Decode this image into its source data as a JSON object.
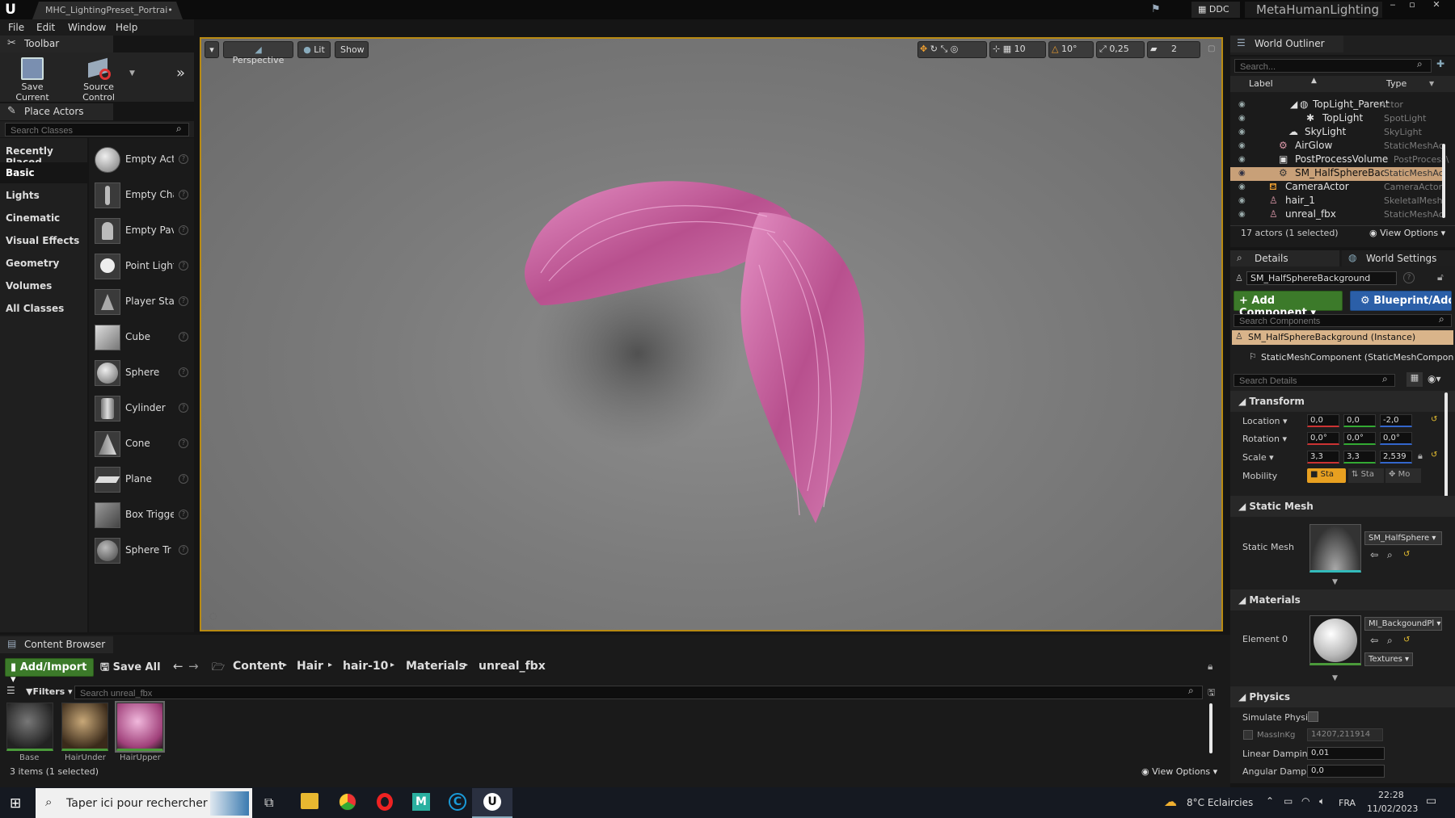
{
  "app": {
    "tab_title": "MHC_LightingPreset_Portrai•",
    "ddc": "DDC",
    "project": "MetaHumanLighting"
  },
  "menu": [
    "File",
    "Edit",
    "Window",
    "Help"
  ],
  "toolbar": {
    "tab": "Toolbar",
    "save_current": "Save Current",
    "source_control": "Source Control"
  },
  "place_actors": {
    "tab": "Place Actors",
    "search_placeholder": "Search Classes",
    "categories": [
      "Recently Placed",
      "Basic",
      "Lights",
      "Cinematic",
      "Visual Effects",
      "Geometry",
      "Volumes",
      "All Classes"
    ],
    "selected_category": "Basic",
    "items": [
      "Empty Act",
      "Empty Cha",
      "Empty Pav",
      "Point Light",
      "Player Sta",
      "Cube",
      "Sphere",
      "Cylinder",
      "Cone",
      "Plane",
      "Box Trigge",
      "Sphere Tr"
    ]
  },
  "viewport": {
    "perspective": "Perspective",
    "lit": "Lit",
    "show": "Show",
    "grid_snap": "10",
    "rot_snap": "10°",
    "scale_snap": "0,25",
    "cam_speed": "2"
  },
  "outliner": {
    "tab": "World Outliner",
    "search_placeholder": "Search...",
    "col_label": "Label",
    "col_type": "Type",
    "rows": [
      {
        "label": "TopLight_Parent",
        "type": "Actor",
        "indent": 1
      },
      {
        "label": "TopLight",
        "type": "SpotLight",
        "indent": 2
      },
      {
        "label": "SkyLight",
        "type": "SkyLight",
        "indent": 1
      },
      {
        "label": "AirGlow",
        "type": "StaticMeshAc",
        "indent": 0
      },
      {
        "label": "PostProcessVolume",
        "type": "PostProcess\\",
        "indent": 0
      },
      {
        "label": "SM_HalfSphereBackg",
        "type": "StaticMeshAc",
        "indent": 0
      },
      {
        "label": "CameraActor",
        "type": "CameraActor",
        "indent": 0
      },
      {
        "label": "hair_1",
        "type": "SkeletalMesh",
        "indent": 0
      },
      {
        "label": "unreal_fbx",
        "type": "StaticMeshAc",
        "indent": 0
      }
    ],
    "status": "17 actors (1 selected)",
    "view_options": "View Options"
  },
  "details": {
    "tab": "Details",
    "tab2": "World Settings",
    "object_name": "SM_HalfSphereBackground",
    "add_component": "Add Component",
    "blueprint": "Blueprint/Add",
    "search_components": "Search Components",
    "instance": "SM_HalfSphereBackground (Instance)",
    "component": "StaticMeshComponent (StaticMeshComponent",
    "search_details": "Search Details",
    "transform": "Transform",
    "location_label": "Location",
    "location": [
      "0,0",
      "0,0",
      "-2,0"
    ],
    "rotation_label": "Rotation",
    "rotation": [
      "0,0°",
      "0,0°",
      "0,0°"
    ],
    "scale_label": "Scale",
    "scale": [
      "3,3",
      "3,3",
      "2,539"
    ],
    "mobility_label": "Mobility",
    "mobility": [
      "Sta",
      "Sta",
      "Mo"
    ],
    "static_mesh_section": "Static Mesh",
    "static_mesh_label": "Static Mesh",
    "static_mesh_value": "SM_HalfSphere",
    "materials_section": "Materials",
    "element0": "Element 0",
    "material_value": "MI_BackgoundPl",
    "textures": "Textures",
    "physics_section": "Physics",
    "simulate": "Simulate Physic",
    "mass_label": "MassInKg",
    "mass_value": "14207,211914",
    "linear_label": "Linear Damping",
    "linear_value": "0,01",
    "angular_label": "Angular Dampin",
    "angular_value": "0,0"
  },
  "content_browser": {
    "tab": "Content Browser",
    "add_import": "Add/Import",
    "save_all": "Save All",
    "breadcrumb": [
      "Content",
      "Hair",
      "hair-10",
      "Materials",
      "unreal_fbx"
    ],
    "filters": "Filters",
    "search_placeholder": "Search unreal_fbx",
    "assets": [
      "Base",
      "HairUnder",
      "HairUpper"
    ],
    "status": "3 items (1 selected)",
    "view_options": "View Options"
  },
  "taskbar": {
    "search_placeholder": "Taper ici pour rechercher",
    "weather": "8°C  Eclaircies",
    "lang": "FRA",
    "time": "22:28",
    "date": "11/02/2023"
  }
}
